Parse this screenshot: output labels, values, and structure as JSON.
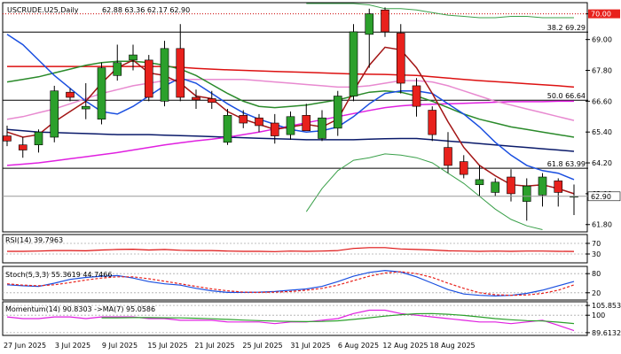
{
  "header": {
    "symbol_label": "USCRUDE.U25,Daily",
    "ohlc_label": "62.88 63.36 62.17 62.90"
  },
  "colors": {
    "bull": "#2ca02c",
    "bear": "#e8211c",
    "ma_dark_red": "#a31515",
    "ma_blue": "#1a4fe0",
    "ma_green": "#2a8a2a",
    "ma_pink": "#e88ad0",
    "ma_magenta": "#e020e0",
    "ma_red": "#dd1111",
    "ma_navy": "#0a1a6a",
    "bollinger": "#3aa04a",
    "level_line": "#000000",
    "resistance_dotted": "#cc0000",
    "price_box_red": "#e8211c"
  },
  "chart_data": [
    {
      "type": "candlestick",
      "title": "USCRUDE.U25,Daily",
      "ohlc_header": "62.88 63.36 62.17 62.90",
      "ylim": [
        61.55,
        70.4
      ],
      "y_ticks": [
        "70.00",
        "69.00",
        "67.80",
        "66.60",
        "65.40",
        "64.20",
        "63.00",
        "61.80"
      ],
      "x_ticks": [
        "27 Jun 2025",
        "3 Jul 2025",
        "9 Jul 2025",
        "15 Jul 2025",
        "21 Jul 2025",
        "25 Jul 2025",
        "31 Jul 2025",
        "6 Aug 2025",
        "12 Aug 2025",
        "18 Aug 2025"
      ],
      "candles": [
        {
          "o": 65.25,
          "h": 65.65,
          "l": 64.85,
          "c": 65.05
        },
        {
          "o": 64.9,
          "h": 65.2,
          "l": 64.4,
          "c": 64.7
        },
        {
          "o": 64.9,
          "h": 65.5,
          "l": 64.6,
          "c": 65.4
        },
        {
          "o": 65.2,
          "h": 67.2,
          "l": 65.0,
          "c": 67.0
        },
        {
          "o": 66.95,
          "h": 67.1,
          "l": 66.6,
          "c": 66.75
        },
        {
          "o": 66.3,
          "h": 67.3,
          "l": 65.9,
          "c": 66.4
        },
        {
          "o": 65.9,
          "h": 68.1,
          "l": 65.7,
          "c": 67.9
        },
        {
          "o": 67.6,
          "h": 68.8,
          "l": 67.4,
          "c": 68.1
        },
        {
          "o": 68.2,
          "h": 68.8,
          "l": 67.8,
          "c": 68.4
        },
        {
          "o": 68.2,
          "h": 68.4,
          "l": 66.6,
          "c": 66.75
        },
        {
          "o": 66.6,
          "h": 68.95,
          "l": 66.4,
          "c": 68.65
        },
        {
          "o": 68.65,
          "h": 69.6,
          "l": 66.6,
          "c": 66.75
        },
        {
          "o": 66.75,
          "h": 67.05,
          "l": 66.3,
          "c": 66.65
        },
        {
          "o": 66.7,
          "h": 67.0,
          "l": 66.3,
          "c": 66.55
        },
        {
          "o": 65.0,
          "h": 66.3,
          "l": 64.9,
          "c": 66.05
        },
        {
          "o": 66.05,
          "h": 66.25,
          "l": 65.55,
          "c": 65.75
        },
        {
          "o": 65.95,
          "h": 66.1,
          "l": 65.4,
          "c": 65.65
        },
        {
          "o": 65.75,
          "h": 66.1,
          "l": 64.95,
          "c": 65.25
        },
        {
          "o": 65.3,
          "h": 66.2,
          "l": 65.1,
          "c": 66.0
        },
        {
          "o": 66.05,
          "h": 66.5,
          "l": 65.6,
          "c": 65.45
        },
        {
          "o": 65.15,
          "h": 66.25,
          "l": 65.05,
          "c": 65.95
        },
        {
          "o": 65.55,
          "h": 67.0,
          "l": 65.25,
          "c": 66.8
        },
        {
          "o": 66.8,
          "h": 69.6,
          "l": 66.6,
          "c": 69.3
        },
        {
          "o": 69.2,
          "h": 70.2,
          "l": 67.9,
          "c": 70.0
        },
        {
          "o": 70.15,
          "h": 70.25,
          "l": 69.1,
          "c": 69.3
        },
        {
          "o": 69.25,
          "h": 69.6,
          "l": 66.9,
          "c": 67.3
        },
        {
          "o": 67.2,
          "h": 67.5,
          "l": 66.0,
          "c": 66.4
        },
        {
          "o": 66.25,
          "h": 66.4,
          "l": 65.05,
          "c": 65.3
        },
        {
          "o": 64.8,
          "h": 65.4,
          "l": 63.8,
          "c": 64.1
        },
        {
          "o": 64.25,
          "h": 64.5,
          "l": 63.6,
          "c": 63.75
        },
        {
          "o": 63.35,
          "h": 64.1,
          "l": 62.9,
          "c": 63.55
        },
        {
          "o": 63.05,
          "h": 63.6,
          "l": 62.9,
          "c": 63.45
        },
        {
          "o": 63.65,
          "h": 63.95,
          "l": 62.7,
          "c": 63.0
        },
        {
          "o": 62.7,
          "h": 63.6,
          "l": 61.95,
          "c": 63.3
        },
        {
          "o": 62.95,
          "h": 63.8,
          "l": 62.5,
          "c": 63.65
        },
        {
          "o": 63.5,
          "h": 63.6,
          "l": 62.5,
          "c": 63.05
        },
        {
          "o": 62.88,
          "h": 63.36,
          "l": 62.17,
          "c": 62.9
        }
      ],
      "moving_averages": [
        {
          "color_key": "ma_red",
          "values": [
            67.95,
            67.95,
            67.95,
            67.95,
            67.95,
            67.95,
            67.95,
            67.95,
            67.95,
            67.95,
            67.95,
            67.92,
            67.88,
            67.85,
            67.82,
            67.8,
            67.78,
            67.76,
            67.74,
            67.72,
            67.7,
            67.68,
            67.66,
            67.65,
            67.64,
            67.62,
            67.6,
            67.55,
            67.5,
            67.45,
            67.4,
            67.36,
            67.32,
            67.28,
            67.24,
            67.2,
            67.15
          ]
        },
        {
          "color_key": "ma_navy",
          "values": [
            65.5,
            65.45,
            65.4,
            65.38,
            65.36,
            65.34,
            65.32,
            65.3,
            65.3,
            65.3,
            65.28,
            65.26,
            65.24,
            65.22,
            65.2,
            65.18,
            65.16,
            65.14,
            65.12,
            65.1,
            65.1,
            65.1,
            65.1,
            65.12,
            65.14,
            65.15,
            65.15,
            65.1,
            65.05,
            65.0,
            64.95,
            64.9,
            64.85,
            64.8,
            64.75,
            64.7,
            64.65
          ]
        },
        {
          "color_key": "ma_magenta",
          "values": [
            64.1,
            64.15,
            64.2,
            64.28,
            64.36,
            64.44,
            64.52,
            64.6,
            64.7,
            64.8,
            64.9,
            64.98,
            65.06,
            65.12,
            65.2,
            65.3,
            65.4,
            65.52,
            65.64,
            65.76,
            65.88,
            66.0,
            66.12,
            66.24,
            66.35,
            66.42,
            66.46,
            66.48,
            66.5,
            66.52,
            66.54,
            66.56,
            66.58,
            66.58,
            66.58,
            66.6,
            66.6
          ]
        },
        {
          "color_key": "ma_pink",
          "values": [
            65.9,
            66.0,
            66.15,
            66.3,
            66.5,
            66.7,
            66.9,
            67.05,
            67.2,
            67.3,
            67.4,
            67.45,
            67.45,
            67.45,
            67.45,
            67.45,
            67.4,
            67.35,
            67.3,
            67.25,
            67.2,
            67.15,
            67.15,
            67.2,
            67.3,
            67.4,
            67.4,
            67.35,
            67.2,
            67.0,
            66.8,
            66.6,
            66.45,
            66.3,
            66.15,
            66.0,
            65.85
          ]
        },
        {
          "color_key": "ma_green",
          "values": [
            67.35,
            67.45,
            67.55,
            67.7,
            67.85,
            68.0,
            68.1,
            68.15,
            68.15,
            68.1,
            68.0,
            67.85,
            67.6,
            67.25,
            66.9,
            66.6,
            66.4,
            66.35,
            66.4,
            66.45,
            66.55,
            66.65,
            66.8,
            66.95,
            67.0,
            66.95,
            66.8,
            66.6,
            66.35,
            66.1,
            65.9,
            65.75,
            65.6,
            65.5,
            65.4,
            65.3,
            65.2
          ]
        },
        {
          "color_key": "ma_blue",
          "values": [
            69.2,
            68.8,
            68.2,
            67.6,
            67.1,
            66.6,
            66.2,
            66.1,
            66.4,
            66.8,
            67.2,
            67.5,
            67.3,
            66.9,
            66.5,
            66.15,
            65.9,
            65.7,
            65.5,
            65.4,
            65.45,
            65.6,
            66.0,
            66.5,
            66.9,
            67.0,
            67.0,
            66.9,
            66.5,
            66.1,
            65.6,
            65.0,
            64.5,
            64.1,
            63.9,
            63.8,
            63.55
          ]
        },
        {
          "color_key": "ma_dark_red",
          "values": [
            65.4,
            65.2,
            65.3,
            65.8,
            66.2,
            66.6,
            67.3,
            67.9,
            68.2,
            67.7,
            67.6,
            67.3,
            66.8,
            66.7,
            66.2,
            65.9,
            65.7,
            65.5,
            65.6,
            65.7,
            65.6,
            65.9,
            67.0,
            68.0,
            68.7,
            68.6,
            67.9,
            66.9,
            65.8,
            64.8,
            64.1,
            63.7,
            63.35,
            63.3,
            63.35,
            63.2,
            63.0
          ]
        },
        {
          "color_key": "bollinger",
          "values": [
            null,
            null,
            null,
            null,
            null,
            null,
            null,
            null,
            null,
            null,
            null,
            null,
            null,
            null,
            null,
            null,
            null,
            null,
            null,
            71.8,
            71.5,
            70.9,
            70.5,
            70.35,
            70.2,
            70.2,
            70.15,
            70.05,
            69.95,
            69.9,
            69.85,
            69.85,
            69.9,
            69.9,
            69.85,
            69.85,
            69.85
          ]
        },
        {
          "color_key": "bollinger",
          "values": [
            null,
            null,
            null,
            null,
            null,
            null,
            null,
            null,
            null,
            null,
            null,
            null,
            null,
            null,
            null,
            null,
            null,
            null,
            null,
            62.3,
            63.2,
            63.9,
            64.3,
            64.4,
            64.55,
            64.5,
            64.4,
            64.2,
            63.8,
            63.4,
            62.9,
            62.4,
            62.0,
            61.75,
            61.6,
            null,
            null
          ]
        }
      ],
      "levels": [
        {
          "value": 69.29,
          "label": "38.2 69.29",
          "style": "solid"
        },
        {
          "value": 66.64,
          "label": "50.0 66.64",
          "style": "solid"
        },
        {
          "value": 63.99,
          "label": "61.8 63.99",
          "style": "solid"
        },
        {
          "value": 70.0,
          "label": "70.00",
          "style": "dotted"
        }
      ],
      "last_price": {
        "value": 62.9,
        "label": "62.90"
      }
    },
    {
      "type": "line",
      "title": "RSI(14) 39.7963",
      "ylim": [
        0,
        100
      ],
      "y_ticks": [
        "70",
        "30"
      ],
      "series": [
        {
          "color_key": "ma_red",
          "values": [
            40,
            40,
            41,
            43,
            43,
            42,
            45,
            47,
            48,
            45,
            47,
            44,
            43,
            43,
            41,
            40,
            40,
            39,
            41,
            40,
            41,
            43,
            51,
            54,
            54,
            49,
            47,
            45,
            42,
            41,
            40,
            41,
            40,
            41,
            41,
            40,
            39.8
          ]
        }
      ]
    },
    {
      "type": "line",
      "title": "Stoch(5,3,3) 55.3619 44.7466",
      "ylim": [
        0,
        100
      ],
      "y_ticks": [
        "80",
        "20"
      ],
      "series": [
        {
          "color_key": "ma_blue",
          "values": [
            45,
            42,
            40,
            50,
            62,
            68,
            72,
            74,
            66,
            55,
            48,
            44,
            34,
            26,
            21,
            21,
            22,
            24,
            28,
            32,
            40,
            55,
            72,
            84,
            90,
            85,
            70,
            50,
            30,
            16,
            12,
            10,
            12,
            18,
            28,
            42,
            55.36
          ]
        },
        {
          "color_key": "bear",
          "values": [
            48,
            44,
            42,
            45,
            52,
            60,
            66,
            70,
            70,
            64,
            56,
            48,
            40,
            32,
            26,
            22,
            21,
            22,
            24,
            28,
            34,
            44,
            58,
            72,
            82,
            86,
            80,
            68,
            50,
            34,
            20,
            14,
            12,
            13,
            18,
            28,
            44.75
          ]
        }
      ]
    },
    {
      "type": "line",
      "title": "Momentum(14) 90.8303 ->MA(7) 95.0586",
      "ylim": [
        88.5,
        107.5
      ],
      "y_ticks": [
        "105.8534",
        "100",
        "89.6132"
      ],
      "series": [
        {
          "color_key": "ma_magenta",
          "values": [
            99,
            98,
            98,
            99,
            99,
            98,
            99,
            99,
            99,
            98,
            98,
            97,
            97,
            97,
            96,
            96,
            96,
            95,
            96,
            96,
            97,
            98,
            101,
            103,
            103,
            101,
            100,
            99,
            98,
            97,
            96,
            96,
            95,
            96,
            97,
            94,
            90.83
          ]
        },
        {
          "color_key": "bull",
          "values": [
            null,
            null,
            null,
            null,
            null,
            null,
            98.5,
            98.5,
            98.6,
            98.6,
            98.5,
            98.4,
            98.2,
            97.9,
            97.5,
            97.1,
            96.8,
            96.5,
            96.3,
            96.2,
            96.3,
            96.7,
            97.5,
            98.5,
            99.5,
            100.3,
            100.9,
            101.0,
            100.6,
            99.9,
            99.0,
            98.0,
            97.3,
            96.8,
            96.6,
            95.9,
            95.06
          ]
        }
      ]
    }
  ]
}
